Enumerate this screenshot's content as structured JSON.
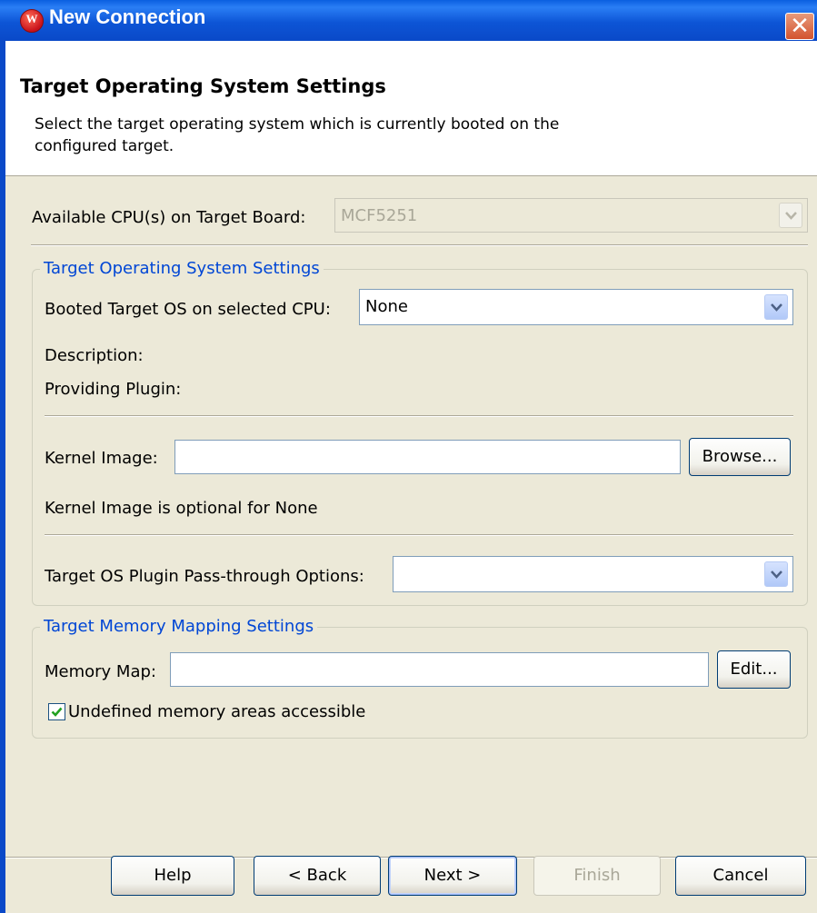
{
  "window": {
    "title": "New Connection",
    "app_icon_letter": "W",
    "close_glyph": "✕"
  },
  "header": {
    "title": "Target Operating System Settings",
    "description": "Select the target operating system which is currently booted on the configured target."
  },
  "cpu": {
    "label": "Available CPU(s) on Target Board:",
    "value": "MCF5251"
  },
  "os_group": {
    "title": "Target Operating System Settings",
    "booted_os_label": "Booted Target OS on selected CPU:",
    "booted_os_value": "None",
    "description_label": "Description:",
    "providing_plugin_label": "Providing Plugin:",
    "kernel_image_label": "Kernel Image:",
    "kernel_image_value": "",
    "browse_label": "Browse...",
    "kernel_note": "Kernel Image is optional for None",
    "passthrough_label": "Target OS Plugin Pass-through Options:",
    "passthrough_value": ""
  },
  "memory_group": {
    "title": "Target Memory Mapping Settings",
    "memory_map_label": "Memory Map:",
    "memory_map_value": "",
    "edit_label": "Edit...",
    "undefined_areas_label": "Undefined memory areas accessible",
    "undefined_areas_checked": true
  },
  "buttons": {
    "help": "Help",
    "back": "< Back",
    "next": "Next >",
    "finish": "Finish",
    "cancel": "Cancel"
  },
  "colors": {
    "titlebar": "#0a49c8",
    "group_label": "#0046d5",
    "dialog_bg": "#ece9d8"
  }
}
